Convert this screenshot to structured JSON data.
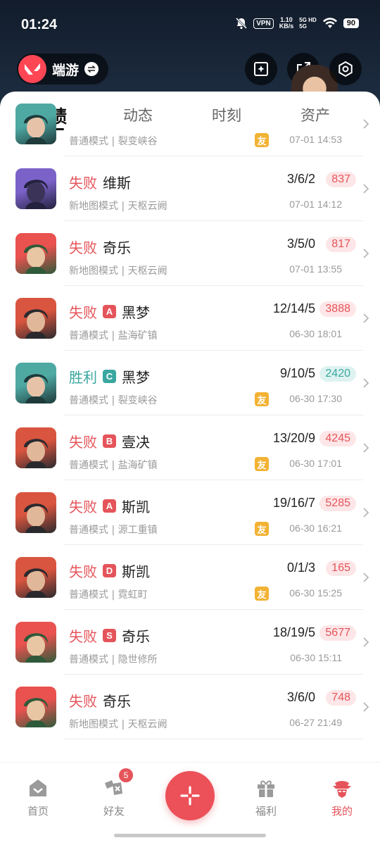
{
  "status_bar": {
    "time": "01:24",
    "vpn": "VPN",
    "speed_value": "1.10",
    "speed_unit": "KB/s",
    "net_top": "5G HD",
    "net_bottom": "5G",
    "battery": "90"
  },
  "header": {
    "mode_label": "端游"
  },
  "tabs": [
    {
      "label": "战绩",
      "active": true
    },
    {
      "label": "动态"
    },
    {
      "label": "时刻"
    },
    {
      "label": "资产"
    }
  ],
  "matches": [
    {
      "result": "",
      "rank": "",
      "agent": "",
      "mode": "普通模式",
      "map": "裂变峡谷",
      "kda": "",
      "score": "",
      "time": "07-01 14:53",
      "friend": "友",
      "outcome": "lose",
      "avatar": "teal"
    },
    {
      "result": "失败",
      "rank": "",
      "agent": "维斯",
      "mode": "新地图模式",
      "map": "天枢云阙",
      "kda": "3/6/2",
      "score": "837",
      "time": "07-01 14:12",
      "friend": "",
      "outcome": "lose",
      "avatar": "purple"
    },
    {
      "result": "失败",
      "rank": "",
      "agent": "奇乐",
      "mode": "新地图模式",
      "map": "天枢云阙",
      "kda": "3/5/0",
      "score": "817",
      "time": "07-01 13:55",
      "friend": "",
      "outcome": "lose",
      "avatar": "green"
    },
    {
      "result": "失败",
      "rank": "A",
      "agent": "黑梦",
      "mode": "普通模式",
      "map": "盐海矿镇",
      "kda": "12/14/5",
      "score": "3888",
      "time": "06-30 18:01",
      "friend": "",
      "outcome": "lose",
      "avatar": "red"
    },
    {
      "result": "胜利",
      "rank": "C",
      "agent": "黑梦",
      "mode": "普通模式",
      "map": "裂变峡谷",
      "kda": "9/10/5",
      "score": "2420",
      "time": "06-30 17:30",
      "friend": "友",
      "outcome": "win",
      "avatar": "teal"
    },
    {
      "result": "失败",
      "rank": "B",
      "agent": "壹决",
      "mode": "普通模式",
      "map": "盐海矿镇",
      "kda": "13/20/9",
      "score": "4245",
      "time": "06-30 17:01",
      "friend": "友",
      "outcome": "lose",
      "avatar": "red"
    },
    {
      "result": "失败",
      "rank": "A",
      "agent": "斯凯",
      "mode": "普通模式",
      "map": "源工重镇",
      "kda": "19/16/7",
      "score": "5285",
      "time": "06-30 16:21",
      "friend": "友",
      "outcome": "lose",
      "avatar": "red"
    },
    {
      "result": "失败",
      "rank": "D",
      "agent": "斯凯",
      "mode": "普通模式",
      "map": "霓虹町",
      "kda": "0/1/3",
      "score": "165",
      "time": "06-30 15:25",
      "friend": "友",
      "outcome": "lose",
      "avatar": "red"
    },
    {
      "result": "失败",
      "rank": "S",
      "agent": "奇乐",
      "mode": "普通模式",
      "map": "隐世修所",
      "kda": "18/19/5",
      "score": "5677",
      "time": "06-30 15:11",
      "friend": "",
      "outcome": "lose",
      "avatar": "green"
    },
    {
      "result": "失败",
      "rank": "",
      "agent": "奇乐",
      "mode": "新地图模式",
      "map": "天枢云阙",
      "kda": "3/6/0",
      "score": "748",
      "time": "06-27 21:49",
      "friend": "",
      "outcome": "lose",
      "avatar": "green"
    }
  ],
  "bottom_nav": {
    "home": "首页",
    "friends": "好友",
    "friends_badge": "5",
    "welfare": "福利",
    "mine": "我的"
  },
  "colors": {
    "lose": "#e5545a",
    "win": "#3aa7a0",
    "accent": "#ec5058",
    "friend_tag": "#f2b233"
  }
}
